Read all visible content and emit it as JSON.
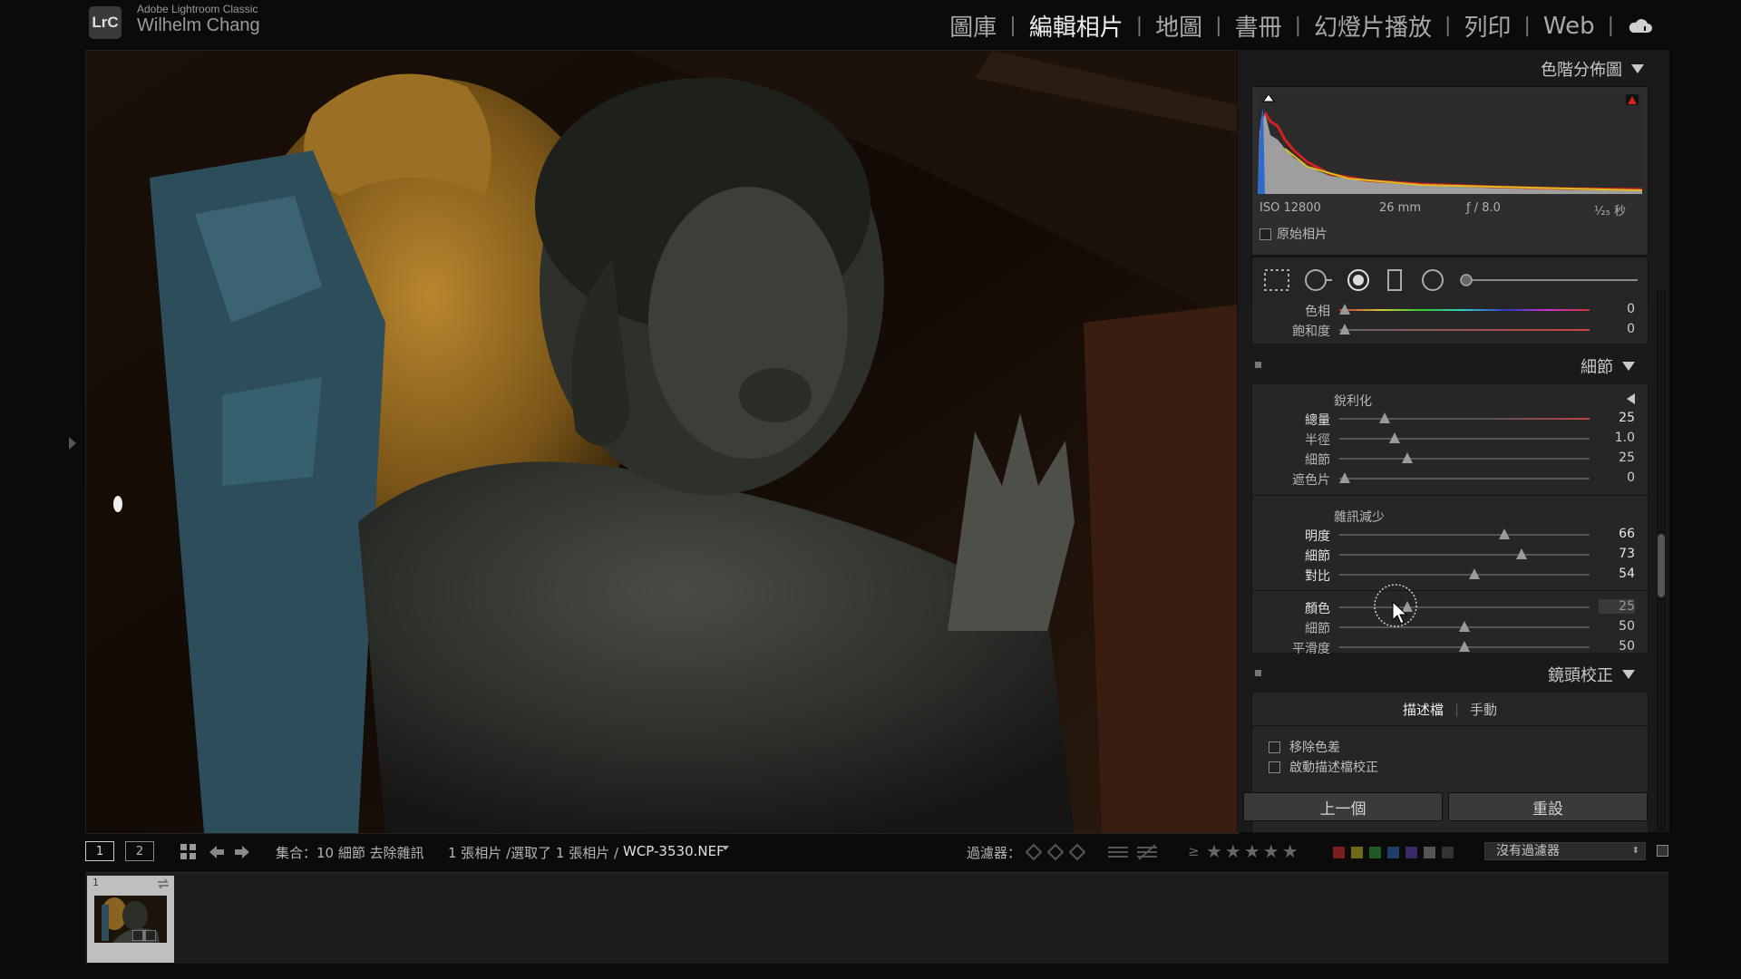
{
  "app": {
    "logo": "LrC",
    "name": "Adobe Lightroom Classic",
    "user": "Wilhelm Chang"
  },
  "modules": {
    "items": [
      "圖庫",
      "編輯相片",
      "地圖",
      "書冊",
      "幻燈片播放",
      "列印",
      "Web"
    ],
    "active": "編輯相片",
    "cloud_icon": "cloud-sync-icon"
  },
  "histogram": {
    "title": "色階分佈圖",
    "iso": "ISO 12800",
    "focal": "26 mm",
    "aperture": "ƒ / 8.0",
    "shutter": "¹⁄₂₅ 秒",
    "original_label": "原始相片"
  },
  "tools": [
    "crop-overlay-icon",
    "spot-removal-icon",
    "red-eye-icon",
    "graduated-filter-icon",
    "radial-filter-icon",
    "adjustment-brush-icon"
  ],
  "hsl_partial": [
    {
      "label": "色相",
      "value": "0",
      "pos": 0.02
    },
    {
      "label": "飽和度",
      "value": "0",
      "pos": 0.02
    }
  ],
  "detail": {
    "title": "細節",
    "sharpening": {
      "title": "銳利化",
      "sliders": [
        {
          "label": "總量",
          "value": "25",
          "pos": 0.18
        },
        {
          "label": "半徑",
          "value": "1.0",
          "pos": 0.22
        },
        {
          "label": "細節",
          "value": "25",
          "pos": 0.27
        },
        {
          "label": "遮色片",
          "value": "0",
          "pos": 0.02
        }
      ]
    },
    "noise": {
      "title": "雜訊減少",
      "luminance": [
        {
          "label": "明度",
          "value": "66",
          "pos": 0.66
        },
        {
          "label": "細節",
          "value": "73",
          "pos": 0.73
        },
        {
          "label": "對比",
          "value": "54",
          "pos": 0.54
        }
      ],
      "color": [
        {
          "label": "顏色",
          "value": "25",
          "pos": 0.27
        },
        {
          "label": "細節",
          "value": "50",
          "pos": 0.5
        },
        {
          "label": "平滑度",
          "value": "50",
          "pos": 0.5
        }
      ]
    }
  },
  "lens": {
    "title": "鏡頭校正",
    "tabs": [
      "描述檔",
      "手動"
    ],
    "options": [
      "移除色差",
      "啟動描述檔校正"
    ]
  },
  "buttons": {
    "previous": "上一個",
    "reset": "重設"
  },
  "toolbar": {
    "screen1": "1",
    "screen2": "2",
    "collection": "集合：10 細節 去除雜訊",
    "photo_count": "1 張相片 /選取了 1 張相片 /",
    "filename": "WCP-3530.NEF",
    "filter_label": "過濾器：",
    "rating_prefix": "≥",
    "filter_value": "沒有過濾器",
    "color_labels": [
      "#7a1e1e",
      "#6e6a1a",
      "#1f5a24",
      "#1e3f66",
      "#3a2a66",
      "#555555",
      "#333333"
    ]
  },
  "filmstrip": {
    "thumb_number": "1"
  }
}
